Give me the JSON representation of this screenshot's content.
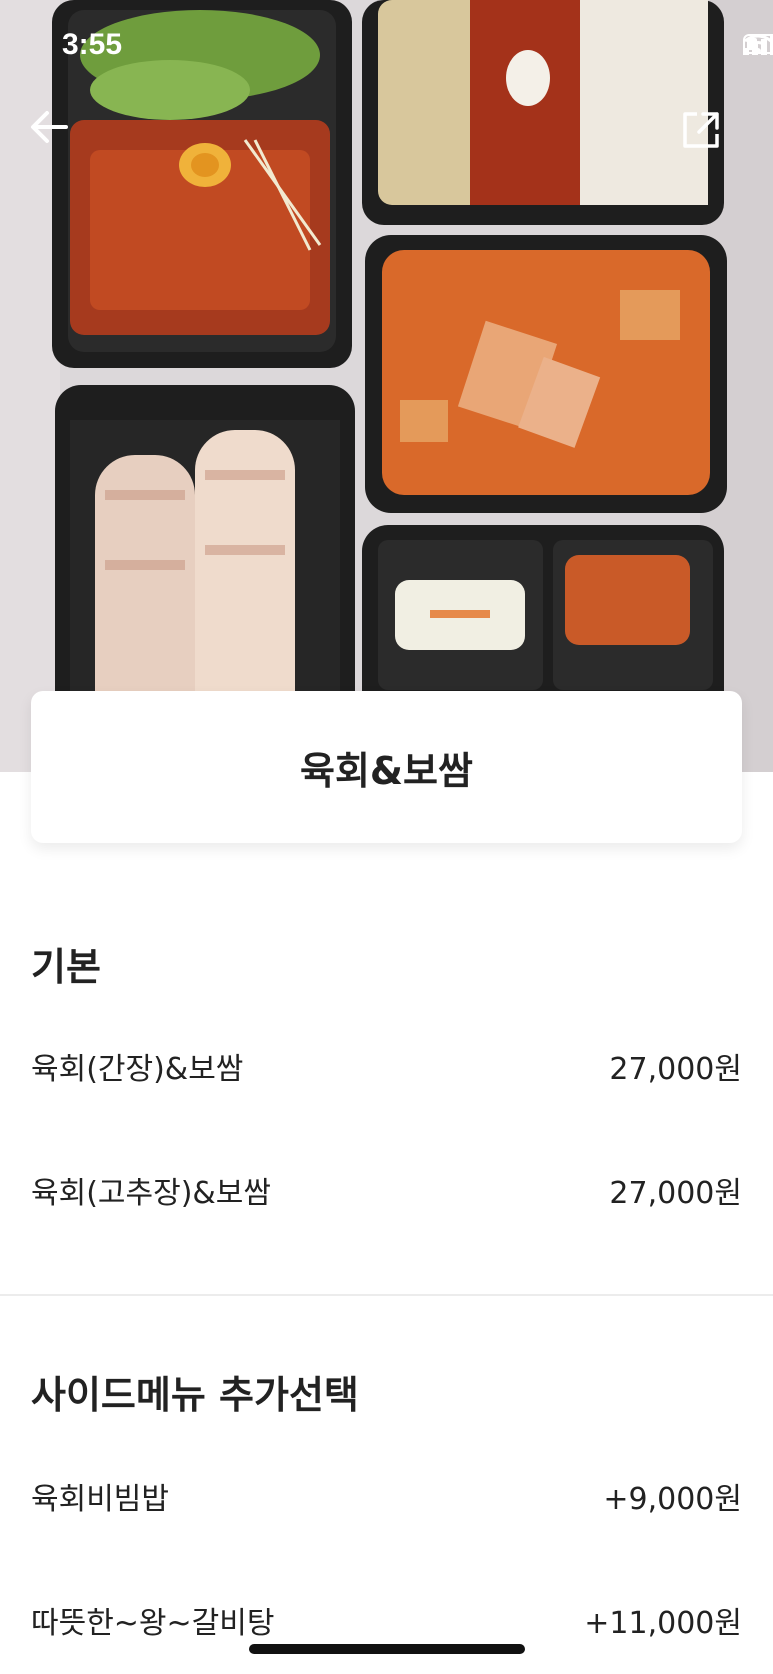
{
  "status_bar": {
    "time": "3:55"
  },
  "title": "육회&보쌈",
  "sections": {
    "basic": {
      "title": "기본",
      "items": [
        {
          "name": "육회(간장)&보쌈",
          "price": "27,000원"
        },
        {
          "name": "육회(고추장)&보쌈",
          "price": "27,000원"
        }
      ]
    },
    "side": {
      "title": "사이드메뉴 추가선택",
      "items": [
        {
          "name": "육회비빔밥",
          "price": "+9,000원"
        },
        {
          "name": "따뜻한~왕~갈비탕",
          "price": "+11,000원"
        }
      ]
    }
  },
  "icons": {
    "back": "arrow-left-icon",
    "share": "share-icon"
  }
}
